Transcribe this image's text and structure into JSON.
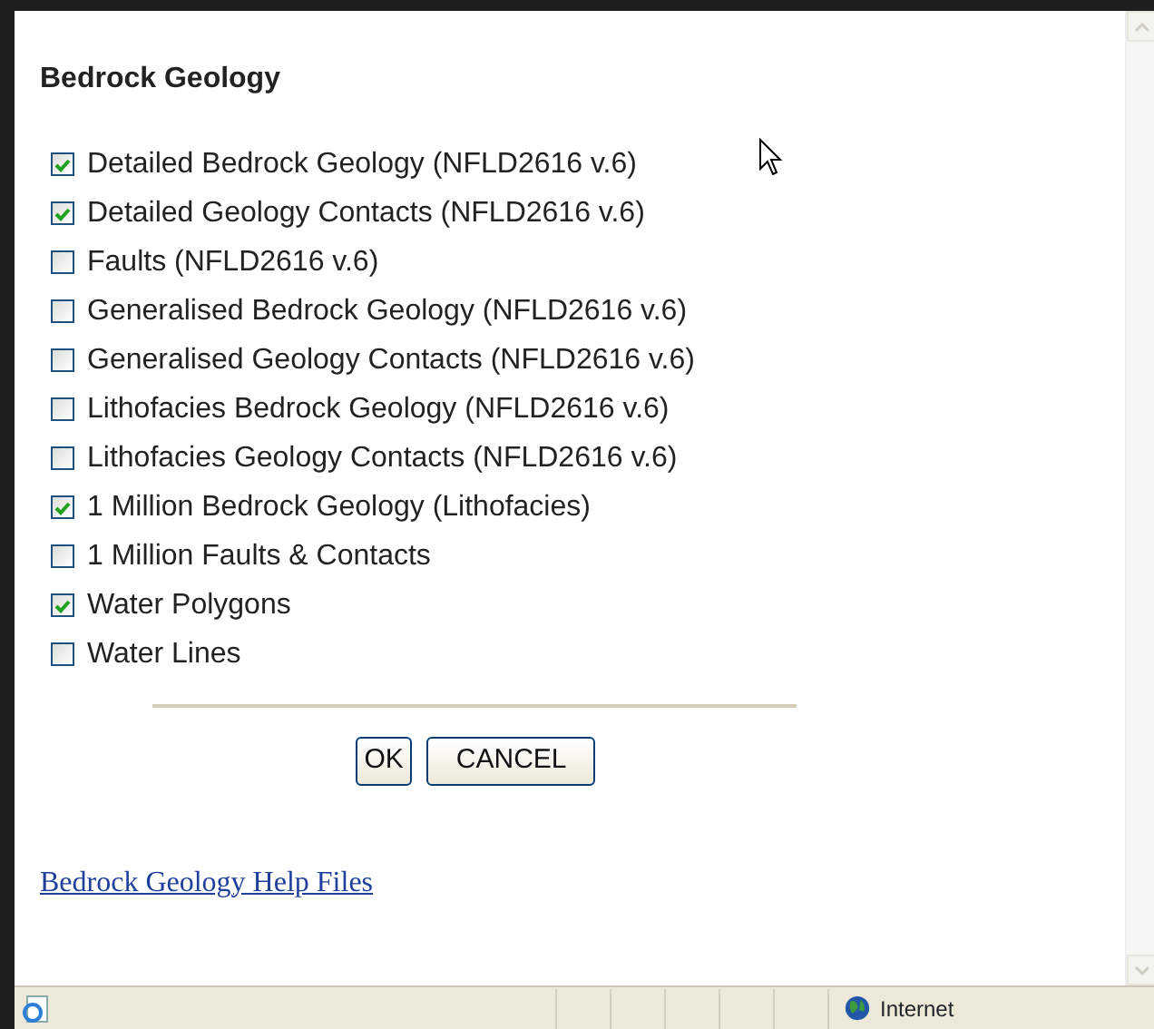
{
  "title": "Bedrock Geology",
  "layers": [
    {
      "label": "Detailed Bedrock Geology (NFLD2616 v.6)",
      "checked": true
    },
    {
      "label": "Detailed Geology Contacts (NFLD2616 v.6)",
      "checked": true
    },
    {
      "label": "Faults (NFLD2616 v.6)",
      "checked": false
    },
    {
      "label": "Generalised Bedrock Geology (NFLD2616 v.6)",
      "checked": false
    },
    {
      "label": "Generalised Geology Contacts (NFLD2616 v.6)",
      "checked": false
    },
    {
      "label": "Lithofacies Bedrock Geology (NFLD2616 v.6)",
      "checked": false
    },
    {
      "label": "Lithofacies Geology Contacts (NFLD2616 v.6)",
      "checked": false
    },
    {
      "label": "1 Million Bedrock Geology (Lithofacies)",
      "checked": true
    },
    {
      "label": "1 Million Faults & Contacts",
      "checked": false
    },
    {
      "label": "Water Polygons",
      "checked": true
    },
    {
      "label": "Water Lines",
      "checked": false
    }
  ],
  "buttons": [
    {
      "label": "OK"
    },
    {
      "label": "CANCEL"
    }
  ],
  "help_link": "Bedrock Geology Help Files",
  "status_bar": {
    "zone": "Internet"
  }
}
